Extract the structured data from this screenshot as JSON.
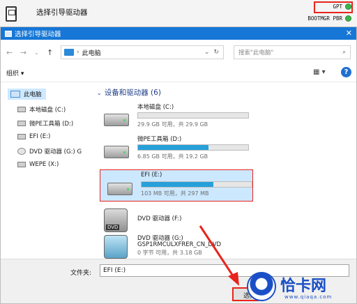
{
  "background_app": {
    "title": "选择引导驱动器",
    "gpt_label": "GPT",
    "mbr_label": "BOOTMGR PBR",
    "status_color": "#3db34a"
  },
  "dialog": {
    "title": "选择引导驱动器",
    "address": "此电脑",
    "search_placeholder": "搜索\"此电脑\"",
    "organize": "组织 ▾"
  },
  "sidebar": {
    "items": [
      {
        "label": "此电脑",
        "icon": "computer-icon"
      },
      {
        "label": "本地磁盘 (C:)",
        "icon": "drive-icon"
      },
      {
        "label": "微PE工具箱 (D:)",
        "icon": "drive-icon"
      },
      {
        "label": "EFI (E:)",
        "icon": "drive-icon"
      },
      {
        "label": "DVD 驱动器 (G:) G",
        "icon": "dvd-icon"
      },
      {
        "label": "WEPE (X:)",
        "icon": "drive-icon"
      }
    ]
  },
  "main": {
    "group_header": "设备和驱动器 (6)",
    "drives": [
      {
        "name": "本地磁盘 (C:)",
        "info": "29.9 GB 可用，共 29.9 GB",
        "used_fraction": 0.0
      },
      {
        "name": "微PE工具箱 (D:)",
        "info": "6.85 GB 可用，共 19.2 GB",
        "used_fraction": 0.64
      },
      {
        "name": "EFI (E:)",
        "info": "103 MB 可用，共 297 MB",
        "used_fraction": 0.65
      },
      {
        "name": "DVD 驱动器 (F:)",
        "info": ""
      },
      {
        "name": "DVD 驱动器 (G:)",
        "line2": "GSP1RMCULXFRER_CN_DVD",
        "info": "0 字节 可用，共 3.18 GB"
      }
    ]
  },
  "bottom": {
    "filename_label": "文件夹:",
    "filename_value": "EFI (E:)",
    "select_button": "选择"
  },
  "watermark": {
    "text": "恰卡网",
    "url": "www.qiaqa.com"
  }
}
